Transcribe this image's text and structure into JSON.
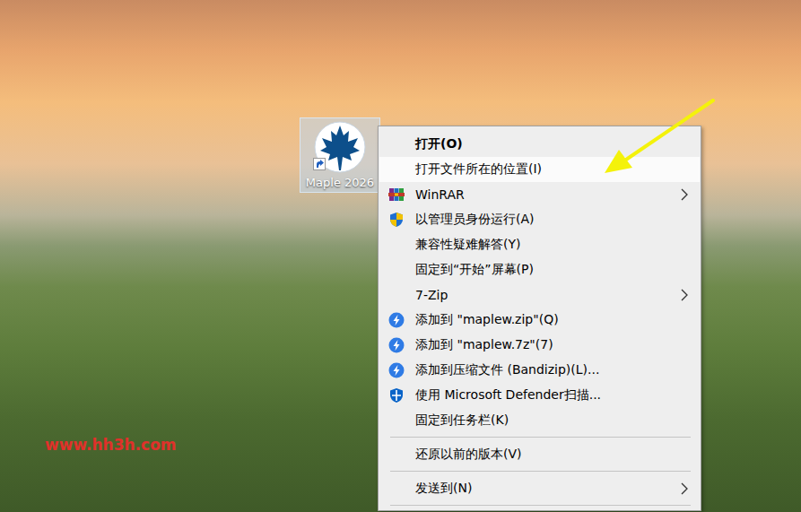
{
  "desktop": {
    "icons": [
      {
        "label": "Maple 2026",
        "selected": true,
        "shortcut": true
      }
    ],
    "watermark": "www.hh3h.com"
  },
  "context_menu": {
    "items": [
      {
        "kind": "item",
        "label": "打开(O)",
        "bold": true,
        "selected": false,
        "submenu": false
      },
      {
        "kind": "item",
        "label": "打开文件所在的位置(I)",
        "bold": false,
        "selected": true,
        "submenu": false
      },
      {
        "kind": "item",
        "label": "WinRAR",
        "bold": false,
        "selected": false,
        "submenu": true
      },
      {
        "kind": "item",
        "label": "以管理员身份运行(A)",
        "bold": false,
        "selected": false,
        "submenu": false
      },
      {
        "kind": "item",
        "label": "兼容性疑难解答(Y)",
        "bold": false,
        "selected": false,
        "submenu": false
      },
      {
        "kind": "item",
        "label": "固定到“开始”屏幕(P)",
        "bold": false,
        "selected": false,
        "submenu": false
      },
      {
        "kind": "item",
        "label": "7-Zip",
        "bold": false,
        "selected": false,
        "submenu": true
      },
      {
        "kind": "item",
        "label": "添加到 \"maplew.zip\"(Q)",
        "bold": false,
        "selected": false,
        "submenu": false
      },
      {
        "kind": "item",
        "label": "添加到 \"maplew.7z\"(7)",
        "bold": false,
        "selected": false,
        "submenu": false
      },
      {
        "kind": "item",
        "label": "添加到压缩文件 (Bandizip)(L)...",
        "bold": false,
        "selected": false,
        "submenu": false
      },
      {
        "kind": "item",
        "label": "使用 Microsoft Defender扫描...",
        "bold": false,
        "selected": false,
        "submenu": false
      },
      {
        "kind": "item",
        "label": "固定到任务栏(K)",
        "bold": false,
        "selected": false,
        "submenu": false
      },
      {
        "kind": "separator"
      },
      {
        "kind": "item",
        "label": "还原以前的版本(V)",
        "bold": false,
        "selected": false,
        "submenu": false
      },
      {
        "kind": "separator"
      },
      {
        "kind": "item",
        "label": "发送到(N)",
        "bold": false,
        "selected": false,
        "submenu": true
      },
      {
        "kind": "separator"
      }
    ]
  }
}
